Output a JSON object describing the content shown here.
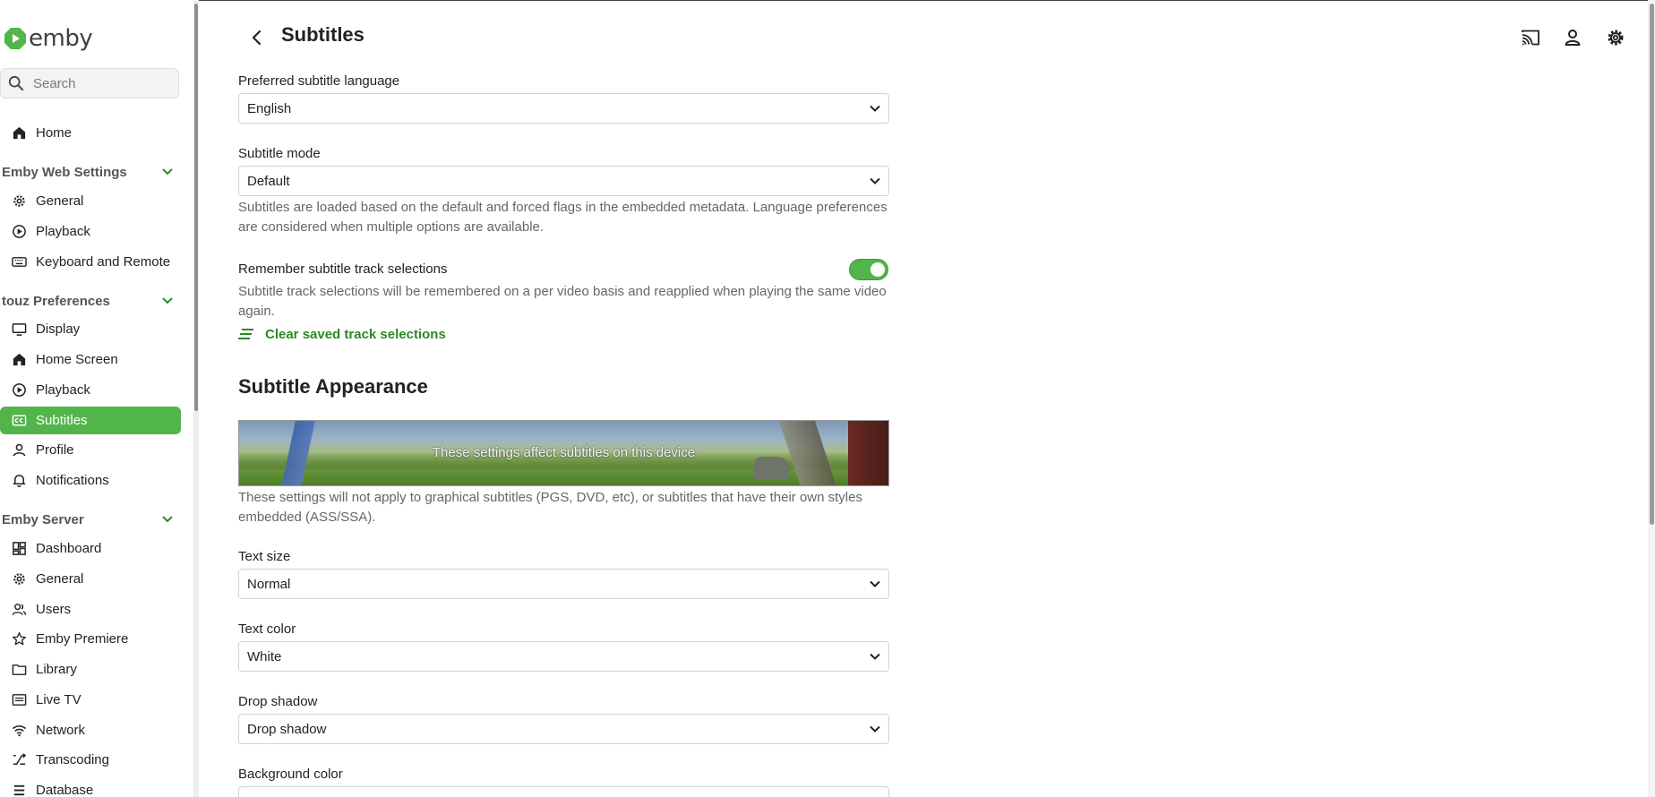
{
  "app": {
    "name": "emby"
  },
  "sidebar": {
    "search_placeholder": "Search",
    "home": "Home",
    "sections": [
      {
        "title": "Emby Web Settings",
        "items": [
          "General",
          "Playback",
          "Keyboard and Remote"
        ]
      },
      {
        "title": "touz Preferences",
        "items": [
          "Display",
          "Home Screen",
          "Playback",
          "Subtitles",
          "Profile",
          "Notifications"
        ]
      },
      {
        "title": "Emby Server",
        "items": [
          "Dashboard",
          "General",
          "Users",
          "Emby Premiere",
          "Library",
          "Live TV",
          "Network",
          "Transcoding",
          "Database"
        ]
      }
    ],
    "active_item": "Subtitles"
  },
  "header": {
    "title": "Subtitles",
    "icons": [
      "cast-icon",
      "user-icon",
      "settings-gear-icon"
    ]
  },
  "form": {
    "preferred_language": {
      "label": "Preferred subtitle language",
      "value": "English"
    },
    "subtitle_mode": {
      "label": "Subtitle mode",
      "value": "Default",
      "help": "Subtitles are loaded based on the default and forced flags in the embedded metadata. Language preferences are considered when multiple options are available."
    },
    "remember_tracks": {
      "label": "Remember subtitle track selections",
      "enabled": true,
      "help": "Subtitle track selections will be remembered on a per video basis and reapplied when playing the same video again."
    },
    "clear_button": "Clear saved track selections",
    "appearance": {
      "heading": "Subtitle Appearance",
      "preview_caption": "These settings affect subtitles on this device",
      "help": "These settings will not apply to graphical subtitles (PGS, DVD, etc), or subtitles that have their own styles embedded (ASS/SSA)."
    },
    "text_size": {
      "label": "Text size",
      "value": "Normal"
    },
    "text_color": {
      "label": "Text color",
      "value": "White"
    },
    "drop_shadow": {
      "label": "Drop shadow",
      "value": "Drop shadow"
    },
    "background_color": {
      "label": "Background color"
    }
  },
  "colors": {
    "accent": "#52b54b",
    "accent_dark": "#2a8a23"
  }
}
